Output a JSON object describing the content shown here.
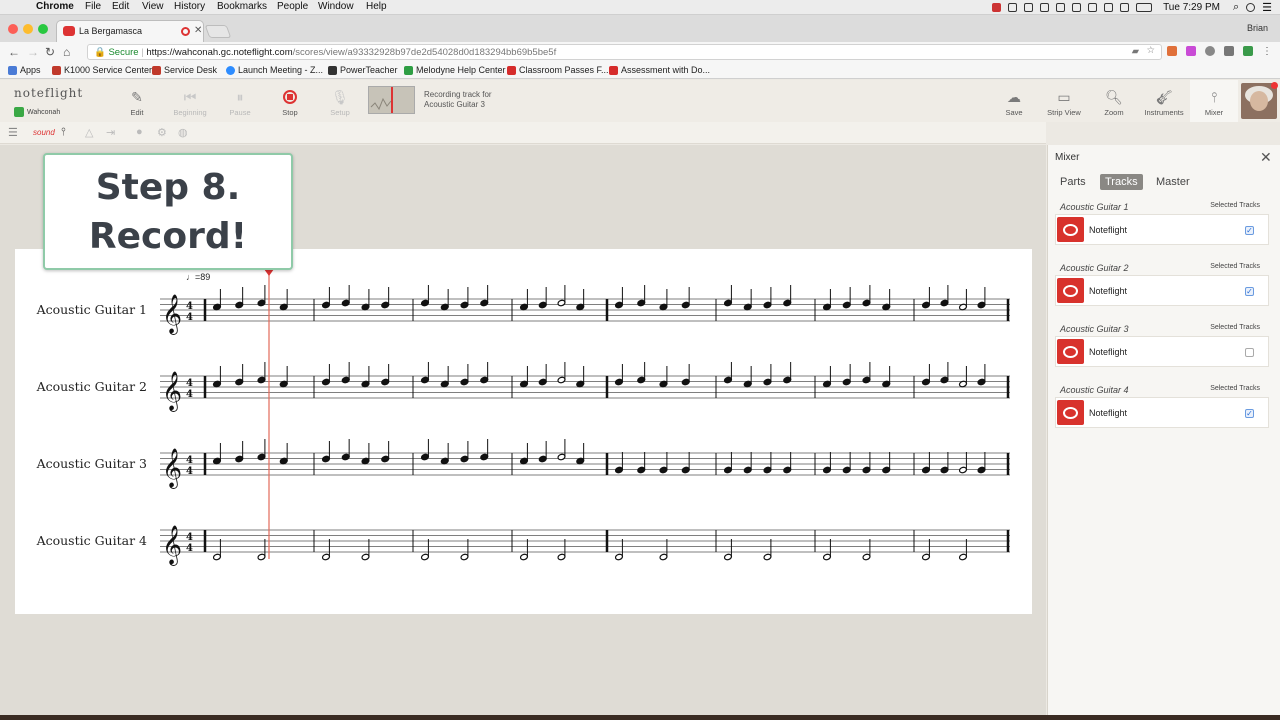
{
  "macbar": {
    "app": "Chrome",
    "menus": [
      "File",
      "Edit",
      "View",
      "History",
      "Bookmarks",
      "People",
      "Window",
      "Help"
    ],
    "clock": "Tue 7:29 PM"
  },
  "browser": {
    "tab_title": "La Bergamasca",
    "profile": "Brian",
    "url_secure": "Secure",
    "url_host": "https://wahconah.gc.noteflight.com",
    "url_path": "/scores/view/a93332928b97de2d54028d0d183294bb69b5be5f",
    "bookmarks": [
      {
        "label": "Apps",
        "color": "#4a7bd6"
      },
      {
        "label": "K1000 Service Center",
        "color": "#c0392b"
      },
      {
        "label": "Service Desk",
        "color": "#c0392b"
      },
      {
        "label": "Launch Meeting - Z...",
        "color": "#2d8cff"
      },
      {
        "label": "PowerTeacher",
        "color": "#333333"
      },
      {
        "label": "Melodyne Help Center",
        "color": "#2e9e44"
      },
      {
        "label": "Classroom Passes F...",
        "color": "#d62c2c"
      },
      {
        "label": "Assessment with Do...",
        "color": "#d62c2c"
      }
    ]
  },
  "toolbar": {
    "logo": "noteflight",
    "org": "Wahconah",
    "edit": "Edit",
    "beginning": "Beginning",
    "pause": "Pause",
    "stop": "Stop",
    "setup": "Setup",
    "rec_line1": "Recording track for",
    "rec_line2": "Acoustic Guitar 3",
    "save": "Save",
    "strip_view": "Strip View",
    "zoom": "Zoom",
    "instruments": "Instruments",
    "mixer": "Mixer"
  },
  "subbar": {
    "sound": "sound"
  },
  "callout": {
    "line1": "Step 8.",
    "line2": "Record!"
  },
  "score": {
    "tempo": "=89",
    "time_signature": "4/4",
    "staves": [
      "Acoustic Guitar 1",
      "Acoustic Guitar 2",
      "Acoustic Guitar 3",
      "Acoustic Guitar 4"
    ]
  },
  "mixer": {
    "title": "Mixer",
    "tabs": [
      "Parts",
      "Tracks",
      "Master"
    ],
    "active_tab": "Tracks",
    "tracks": [
      {
        "name": "Acoustic Guitar 1",
        "selected_label": "Selected Tracks",
        "source": "Noteflight",
        "checked": true
      },
      {
        "name": "Acoustic Guitar 2",
        "selected_label": "Selected Tracks",
        "source": "Noteflight",
        "checked": true
      },
      {
        "name": "Acoustic Guitar 3",
        "selected_label": "Selected Tracks",
        "source": "Noteflight",
        "checked": false
      },
      {
        "name": "Acoustic Guitar 4",
        "selected_label": "Selected Tracks",
        "source": "Noteflight",
        "checked": true
      }
    ]
  },
  "colors": {
    "record": "#d33333",
    "callout_border": "#8fcaa8",
    "tab_active": "#8a8884"
  }
}
